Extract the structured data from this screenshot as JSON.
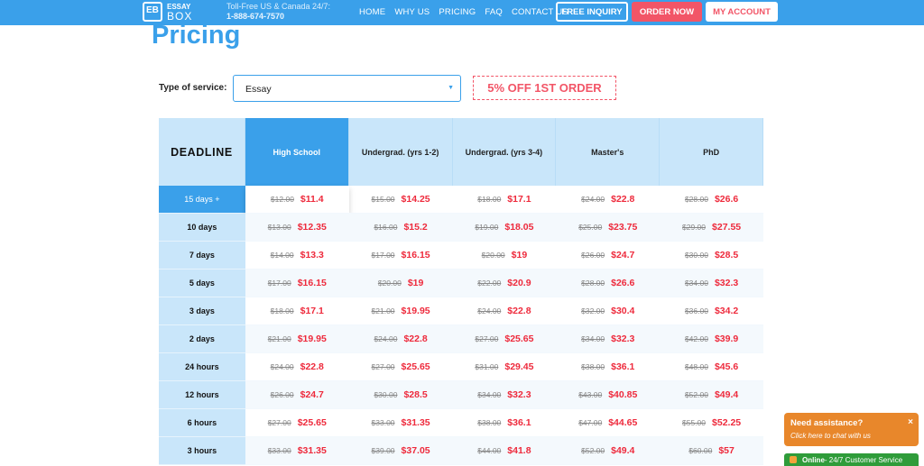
{
  "header": {
    "logo_line1": "ESSAY",
    "logo_line2": "BOX",
    "logo_mark": "EB",
    "tollfree": "Toll-Free US & Canada 24/7:",
    "phone": "1-888-674-7570",
    "nav": [
      "HOME",
      "WHY US",
      "PRICING",
      "FAQ",
      "CONTACT US"
    ],
    "free_inquiry": "FREE INQUIRY",
    "order_now": "ORDER NOW",
    "my_account": "MY ACCOUNT",
    "colors": {
      "brand_blue": "#3aa0ea",
      "accent_red": "#f25567"
    }
  },
  "page_title": "Pricing",
  "service": {
    "label": "Type of service:",
    "selected": "Essay"
  },
  "promo": "5% OFF 1ST ORDER",
  "table": {
    "deadline_header": "DEADLINE",
    "levels": [
      "High School",
      "Undergrad. (yrs 1-2)",
      "Undergrad. (yrs 3-4)",
      "Master's",
      "PhD"
    ],
    "rows": [
      {
        "deadline": "15 days +",
        "prices": [
          [
            "$12.00",
            "$11.4"
          ],
          [
            "$15.00",
            "$14.25"
          ],
          [
            "$18.00",
            "$17.1"
          ],
          [
            "$24.00",
            "$22.8"
          ],
          [
            "$28.00",
            "$26.6"
          ]
        ]
      },
      {
        "deadline": "10 days",
        "prices": [
          [
            "$13.00",
            "$12.35"
          ],
          [
            "$16.00",
            "$15.2"
          ],
          [
            "$19.00",
            "$18.05"
          ],
          [
            "$25.00",
            "$23.75"
          ],
          [
            "$29.00",
            "$27.55"
          ]
        ]
      },
      {
        "deadline": "7 days",
        "prices": [
          [
            "$14.00",
            "$13.3"
          ],
          [
            "$17.00",
            "$16.15"
          ],
          [
            "$20.00",
            "$19"
          ],
          [
            "$26.00",
            "$24.7"
          ],
          [
            "$30.00",
            "$28.5"
          ]
        ]
      },
      {
        "deadline": "5 days",
        "prices": [
          [
            "$17.00",
            "$16.15"
          ],
          [
            "$20.00",
            "$19"
          ],
          [
            "$22.00",
            "$20.9"
          ],
          [
            "$28.00",
            "$26.6"
          ],
          [
            "$34.00",
            "$32.3"
          ]
        ]
      },
      {
        "deadline": "3 days",
        "prices": [
          [
            "$18.00",
            "$17.1"
          ],
          [
            "$21.00",
            "$19.95"
          ],
          [
            "$24.00",
            "$22.8"
          ],
          [
            "$32.00",
            "$30.4"
          ],
          [
            "$36.00",
            "$34.2"
          ]
        ]
      },
      {
        "deadline": "2 days",
        "prices": [
          [
            "$21.00",
            "$19.95"
          ],
          [
            "$24.00",
            "$22.8"
          ],
          [
            "$27.00",
            "$25.65"
          ],
          [
            "$34.00",
            "$32.3"
          ],
          [
            "$42.00",
            "$39.9"
          ]
        ]
      },
      {
        "deadline": "24 hours",
        "prices": [
          [
            "$24.00",
            "$22.8"
          ],
          [
            "$27.00",
            "$25.65"
          ],
          [
            "$31.00",
            "$29.45"
          ],
          [
            "$38.00",
            "$36.1"
          ],
          [
            "$48.00",
            "$45.6"
          ]
        ]
      },
      {
        "deadline": "12 hours",
        "prices": [
          [
            "$26.00",
            "$24.7"
          ],
          [
            "$30.00",
            "$28.5"
          ],
          [
            "$34.00",
            "$32.3"
          ],
          [
            "$43.00",
            "$40.85"
          ],
          [
            "$52.00",
            "$49.4"
          ]
        ]
      },
      {
        "deadline": "6 hours",
        "prices": [
          [
            "$27.00",
            "$25.65"
          ],
          [
            "$33.00",
            "$31.35"
          ],
          [
            "$38.00",
            "$36.1"
          ],
          [
            "$47.00",
            "$44.65"
          ],
          [
            "$55.00",
            "$52.25"
          ]
        ]
      },
      {
        "deadline": "3 hours",
        "prices": [
          [
            "$33.00",
            "$31.35"
          ],
          [
            "$39.00",
            "$37.05"
          ],
          [
            "$44.00",
            "$41.8"
          ],
          [
            "$52.00",
            "$49.4"
          ],
          [
            "$60.00",
            "$57"
          ]
        ]
      }
    ]
  },
  "chat": {
    "heading": "Need assistance?",
    "sub": "Click here to chat with us",
    "close": "×",
    "status": "Online",
    "status_sub": " - 24/7 Customer Service"
  }
}
